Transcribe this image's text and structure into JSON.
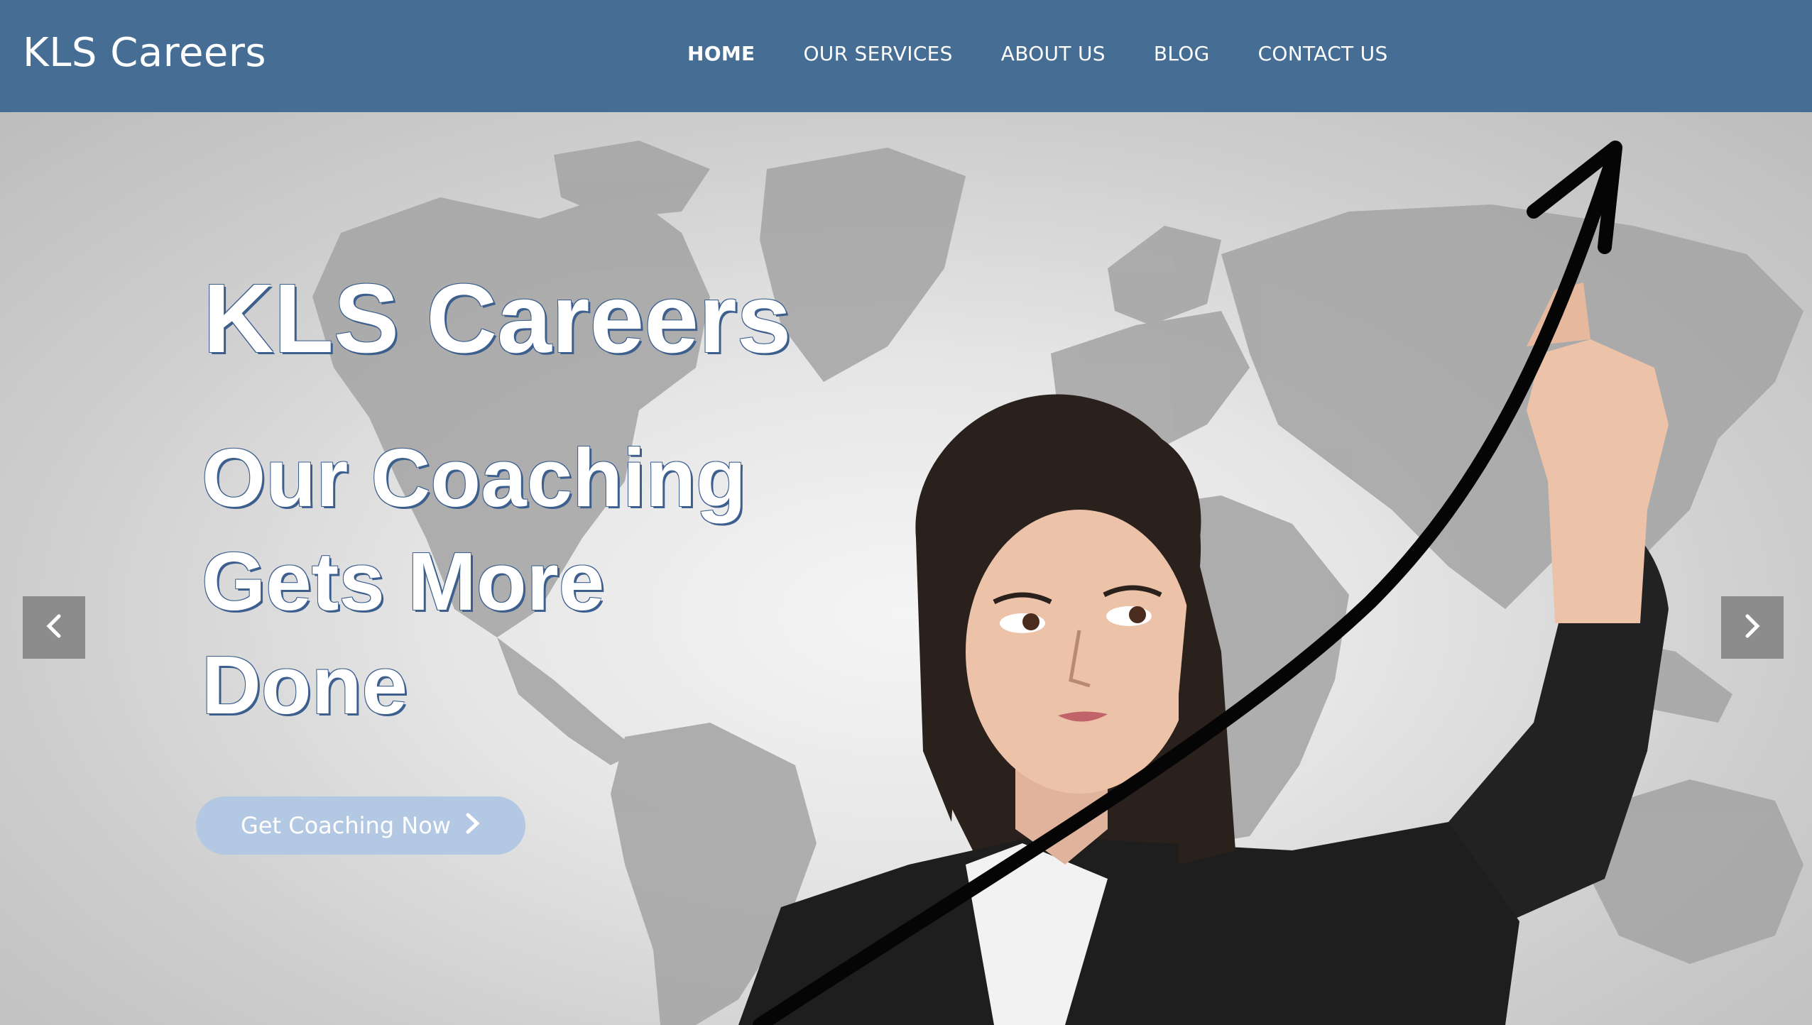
{
  "header": {
    "brand": "KLS Careers",
    "nav": [
      {
        "label": "HOME",
        "active": true
      },
      {
        "label": "OUR SERVICES",
        "active": false
      },
      {
        "label": "ABOUT US",
        "active": false
      },
      {
        "label": "BLOG",
        "active": false
      },
      {
        "label": "CONTACT US",
        "active": false
      }
    ],
    "background_color": "#466d94"
  },
  "hero": {
    "title": "KLS Careers",
    "subtitle": "Our Coaching Gets More Done",
    "cta_label": "Get Coaching Now",
    "cta_icon": "chevron-right-icon",
    "cta_color": "#b3c8e2",
    "prev_icon": "chevron-left-icon",
    "next_icon": "chevron-right-icon",
    "background_image": "world map with businesswoman drawing upward arrow"
  }
}
